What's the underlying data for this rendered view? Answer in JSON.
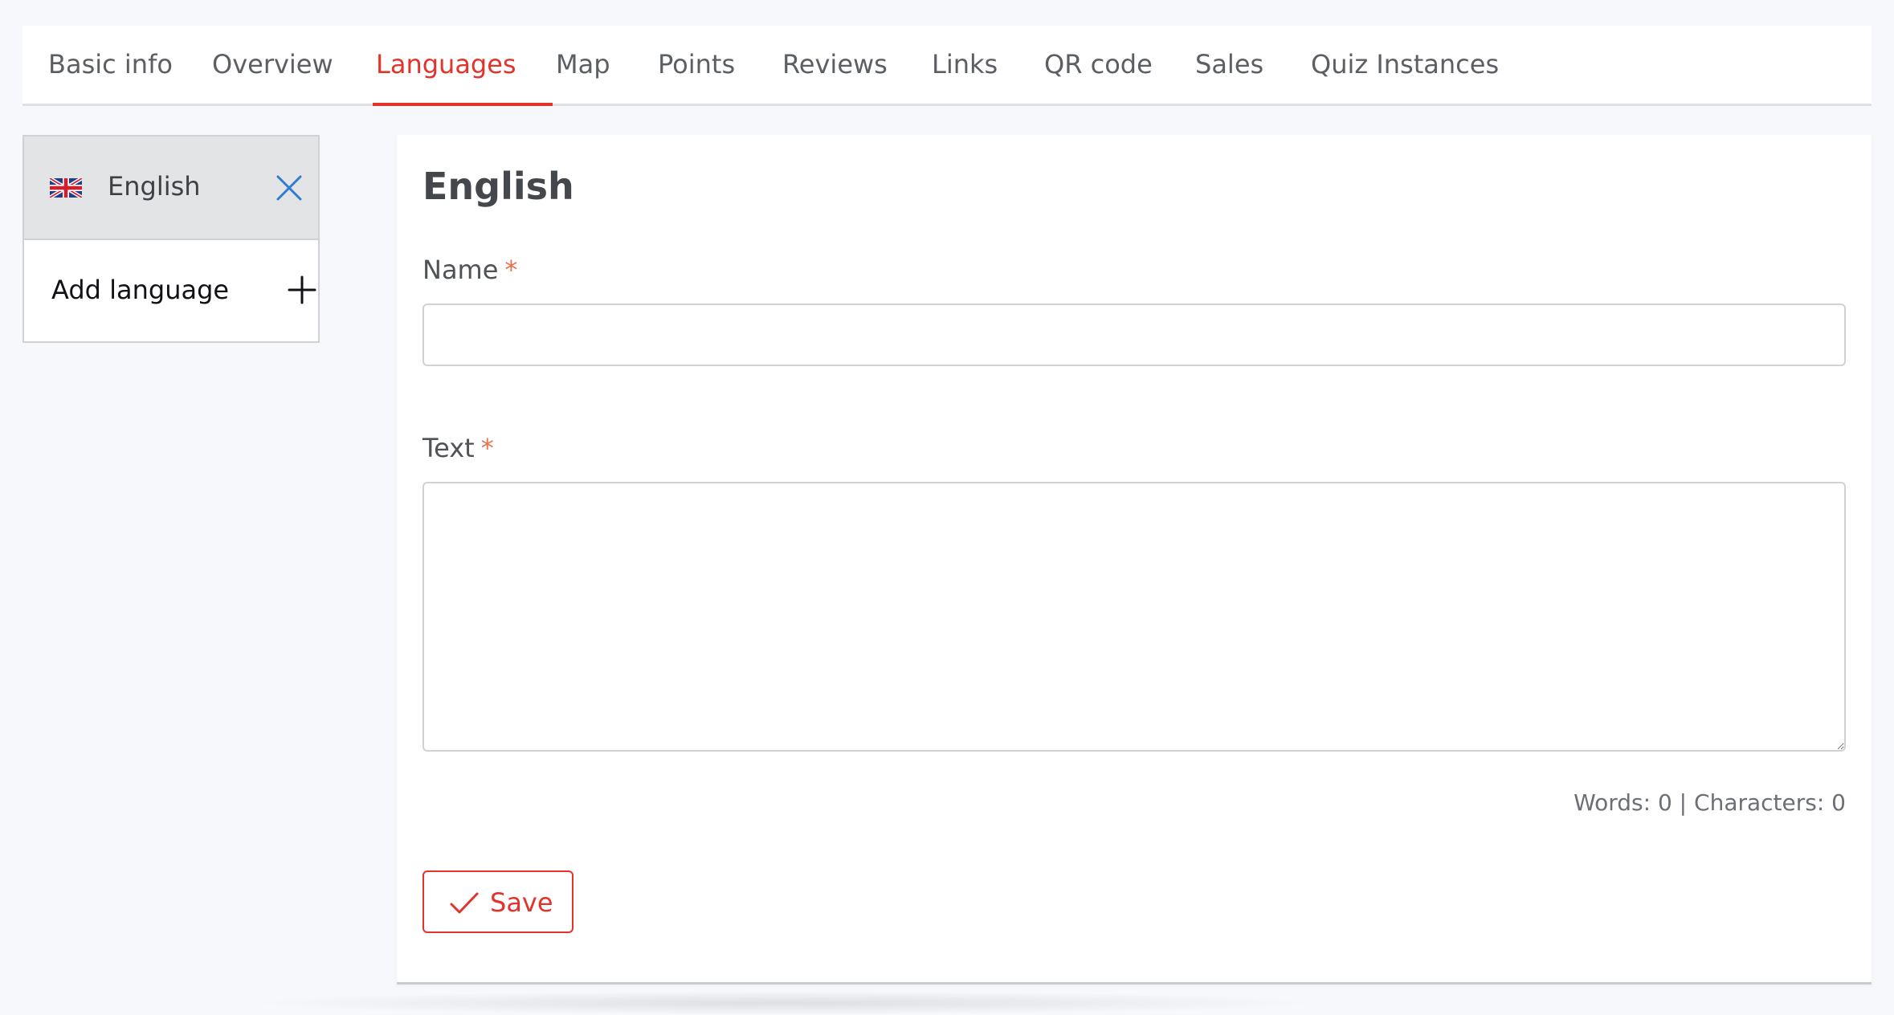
{
  "tabs": [
    {
      "label": "Basic info",
      "active": false
    },
    {
      "label": "Overview",
      "active": false
    },
    {
      "label": "Languages",
      "active": true
    },
    {
      "label": "Map",
      "active": false
    },
    {
      "label": "Points",
      "active": false
    },
    {
      "label": "Reviews",
      "active": false
    },
    {
      "label": "Links",
      "active": false
    },
    {
      "label": "QR code",
      "active": false
    },
    {
      "label": "Sales",
      "active": false
    },
    {
      "label": "Quiz Instances",
      "active": false
    }
  ],
  "languages": {
    "items": [
      {
        "label": "English",
        "flag_icon": "uk-flag-icon",
        "remove_icon": "close-icon"
      }
    ],
    "add_label": "Add language",
    "add_icon": "plus-icon"
  },
  "form": {
    "title": "English",
    "name_label": "Name",
    "name_required": "*",
    "name_value": "",
    "text_label": "Text",
    "text_required": "*",
    "text_value": "",
    "counter": "Words: 0 | Characters: 0",
    "save_label": "Save",
    "save_icon": "check-icon"
  },
  "colors": {
    "accent": "#e2342b",
    "required": "#e8704a",
    "remove_icon": "#2f7bd6",
    "background": "#f6f8fb"
  }
}
